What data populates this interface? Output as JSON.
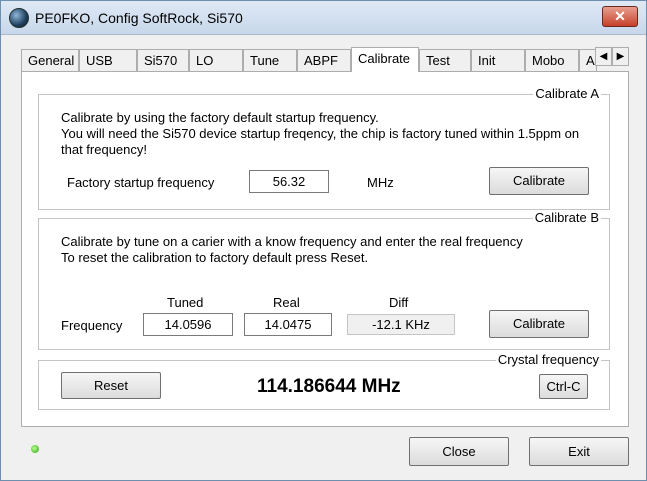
{
  "window": {
    "title": "PE0FKO, Config SoftRock, Si570",
    "close_glyph": "✕"
  },
  "tabs": [
    "General",
    "USB",
    "Si570",
    "LO",
    "Tune",
    "ABPF",
    "Calibrate",
    "Test",
    "Init",
    "Mobo",
    "A"
  ],
  "active_tab": "Calibrate",
  "calibrate_a": {
    "title": "Calibrate  A",
    "line1": "Calibrate by using the factory default startup frequency.",
    "line2": "You will need the Si570 device startup freqency, the chip is factory tuned within 1.5ppm on",
    "line3": "that frequency!",
    "freq_label": "Factory startup frequency",
    "freq_value": "56.32",
    "unit": "MHz",
    "button": "Calibrate"
  },
  "calibrate_b": {
    "title": "Calibrate  B",
    "line1": "Calibrate by tune on a carier with a know frequency and enter the real frequency",
    "line2": "To reset the calibration to factory default press Reset.",
    "col_tuned": "Tuned",
    "col_real": "Real",
    "col_diff": "Diff",
    "row_label": "Frequency",
    "tuned_value": "14.0596",
    "real_value": "14.0475",
    "diff_value": "-12.1 KHz",
    "button": "Calibrate"
  },
  "crystal": {
    "title": "Crystal frequency",
    "reset_button": "Reset",
    "value": "114.186644 MHz",
    "ctrlc_button": "Ctrl-C"
  },
  "footer": {
    "close_button": "Close",
    "exit_button": "Exit"
  }
}
